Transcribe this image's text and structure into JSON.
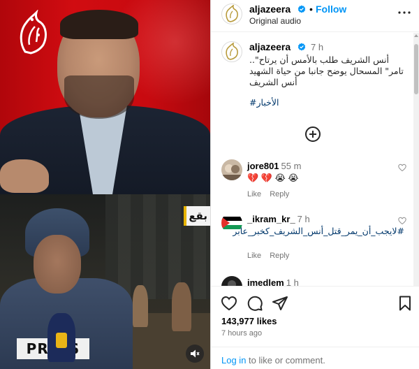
{
  "post": {
    "username": "aljazeera",
    "separator": "•",
    "follow_label": "Follow",
    "audio_label": "Original audio",
    "caption_time": "7 h",
    "caption_text": "أنس الشريف طلب بالأمس أن يرتاح\".. تامر\" المسحال يوضح جانبا من حياة الشهيد أنس الشريف",
    "hashtag": "#الأخبار",
    "video_caption_fragment": "بقع",
    "press_label": "PRESS"
  },
  "comments": [
    {
      "username": "jore801",
      "time": "55 m",
      "text": "💔 💔 😭 😭",
      "like_label": "Like",
      "reply_label": "Reply"
    },
    {
      "username": "_ikram_kr_",
      "time": "7 h",
      "text": "#لايجب_أن_يمر_قتل_أنس_الشريف_كخبر_عابر",
      "like_label": "Like",
      "reply_label": "Reply"
    },
    {
      "username": "imedlem",
      "time": "1 h"
    }
  ],
  "stats": {
    "likes": "143,977 likes",
    "time_ago": "7 hours ago"
  },
  "login": {
    "link": "Log in",
    "rest": " to like or comment."
  },
  "icons": {
    "verified": "verified-badge-icon",
    "more": "more-options-icon",
    "plus": "plus-circle-icon",
    "heart": "heart-icon",
    "comment": "comment-icon",
    "share": "share-icon",
    "save": "bookmark-icon",
    "mute": "speaker-muted-icon"
  },
  "colors": {
    "accent": "#0095f6",
    "verified": "#0095f6",
    "hashtag": "#00376b",
    "muted": "#737373",
    "brand_red": "#c80a10"
  }
}
